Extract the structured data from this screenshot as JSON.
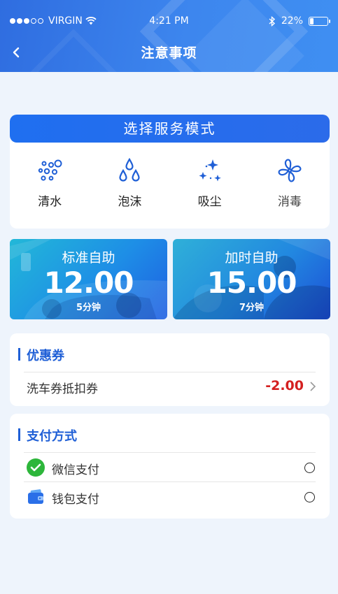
{
  "status_bar": {
    "carrier": "VIRGIN",
    "time": "4:21 PM",
    "battery": "22%",
    "battery_level": 0.22
  },
  "nav": {
    "title": "注意事项",
    "back_icon": "chevron-left-icon"
  },
  "service_mode": {
    "title": "选择服务模式",
    "modes": [
      {
        "label": "清水",
        "icon": "water-bubbles-icon"
      },
      {
        "label": "泡沫",
        "icon": "foam-drops-icon"
      },
      {
        "label": "吸尘",
        "icon": "sparkle-dust-icon"
      },
      {
        "label": "消毒",
        "icon": "fan-disinfect-icon"
      }
    ]
  },
  "plans": [
    {
      "title": "标准自助",
      "price": "12.00",
      "duration": "5分钟"
    },
    {
      "title": "加时自助",
      "price": "15.00",
      "duration": "7分钟"
    }
  ],
  "coupon": {
    "section_title": "优惠券",
    "item_label": "洗车券抵扣券",
    "amount": "-2.00",
    "amount_color": "#d42020"
  },
  "payment": {
    "section_title": "支付方式",
    "options": [
      {
        "label": "微信支付",
        "icon": "wechat-pay-icon",
        "selected": false
      },
      {
        "label": "钱包支付",
        "icon": "wallet-icon",
        "selected": false
      }
    ]
  },
  "colors": {
    "accent": "#1f6ff0",
    "section_title": "#1f5fd6",
    "background": "#eef4fc"
  }
}
